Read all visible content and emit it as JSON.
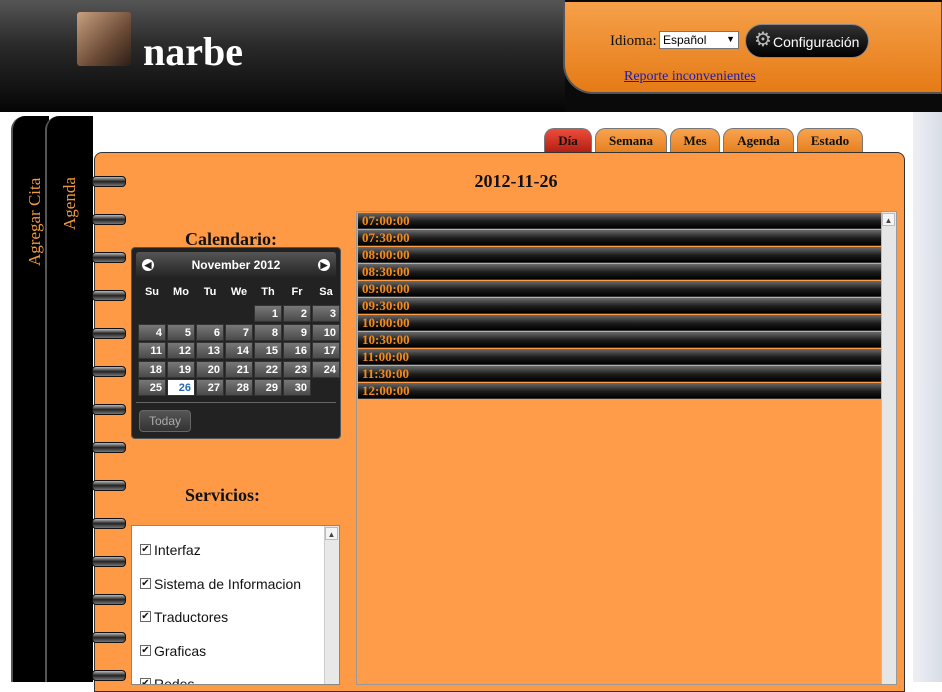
{
  "header": {
    "username": "narbe",
    "language_label": "Idioma:",
    "language_value": "Español",
    "config_label": "Configuración",
    "report_link": "Reporte inconvenientes"
  },
  "sidebar": {
    "add_appointment": "Agregar Cita",
    "agenda": "Agenda"
  },
  "tabs": [
    "Día",
    "Semana",
    "Mes",
    "Agenda",
    "Estado"
  ],
  "active_tab": "Día",
  "date_title": "2012-11-26",
  "calendar": {
    "title": "Calendario:",
    "month_label": "November 2012",
    "weekdays": [
      "Su",
      "Mo",
      "Tu",
      "We",
      "Th",
      "Fr",
      "Sa"
    ],
    "weeks": [
      [
        "",
        "",
        "",
        "",
        "1",
        "2",
        "3"
      ],
      [
        "4",
        "5",
        "6",
        "7",
        "8",
        "9",
        "10"
      ],
      [
        "11",
        "12",
        "13",
        "14",
        "15",
        "16",
        "17"
      ],
      [
        "18",
        "19",
        "20",
        "21",
        "22",
        "23",
        "24"
      ],
      [
        "25",
        "26",
        "27",
        "28",
        "29",
        "30",
        ""
      ]
    ],
    "selected_day": "26",
    "today_label": "Today"
  },
  "services": {
    "title": "Servicios:",
    "items": [
      "Interfaz",
      "Sistema de Informacion",
      "Traductores",
      "Graficas",
      "Redes"
    ]
  },
  "time_slots": [
    "07:00:00",
    "07:30:00",
    "08:00:00",
    "08:30:00",
    "09:00:00",
    "09:30:00",
    "10:00:00",
    "10:30:00",
    "11:00:00",
    "11:30:00",
    "12:00:00"
  ],
  "colors": {
    "accent_orange": "#fe9a46",
    "active_tab": "#d32f1e",
    "slot_text": "#f58a1c"
  }
}
